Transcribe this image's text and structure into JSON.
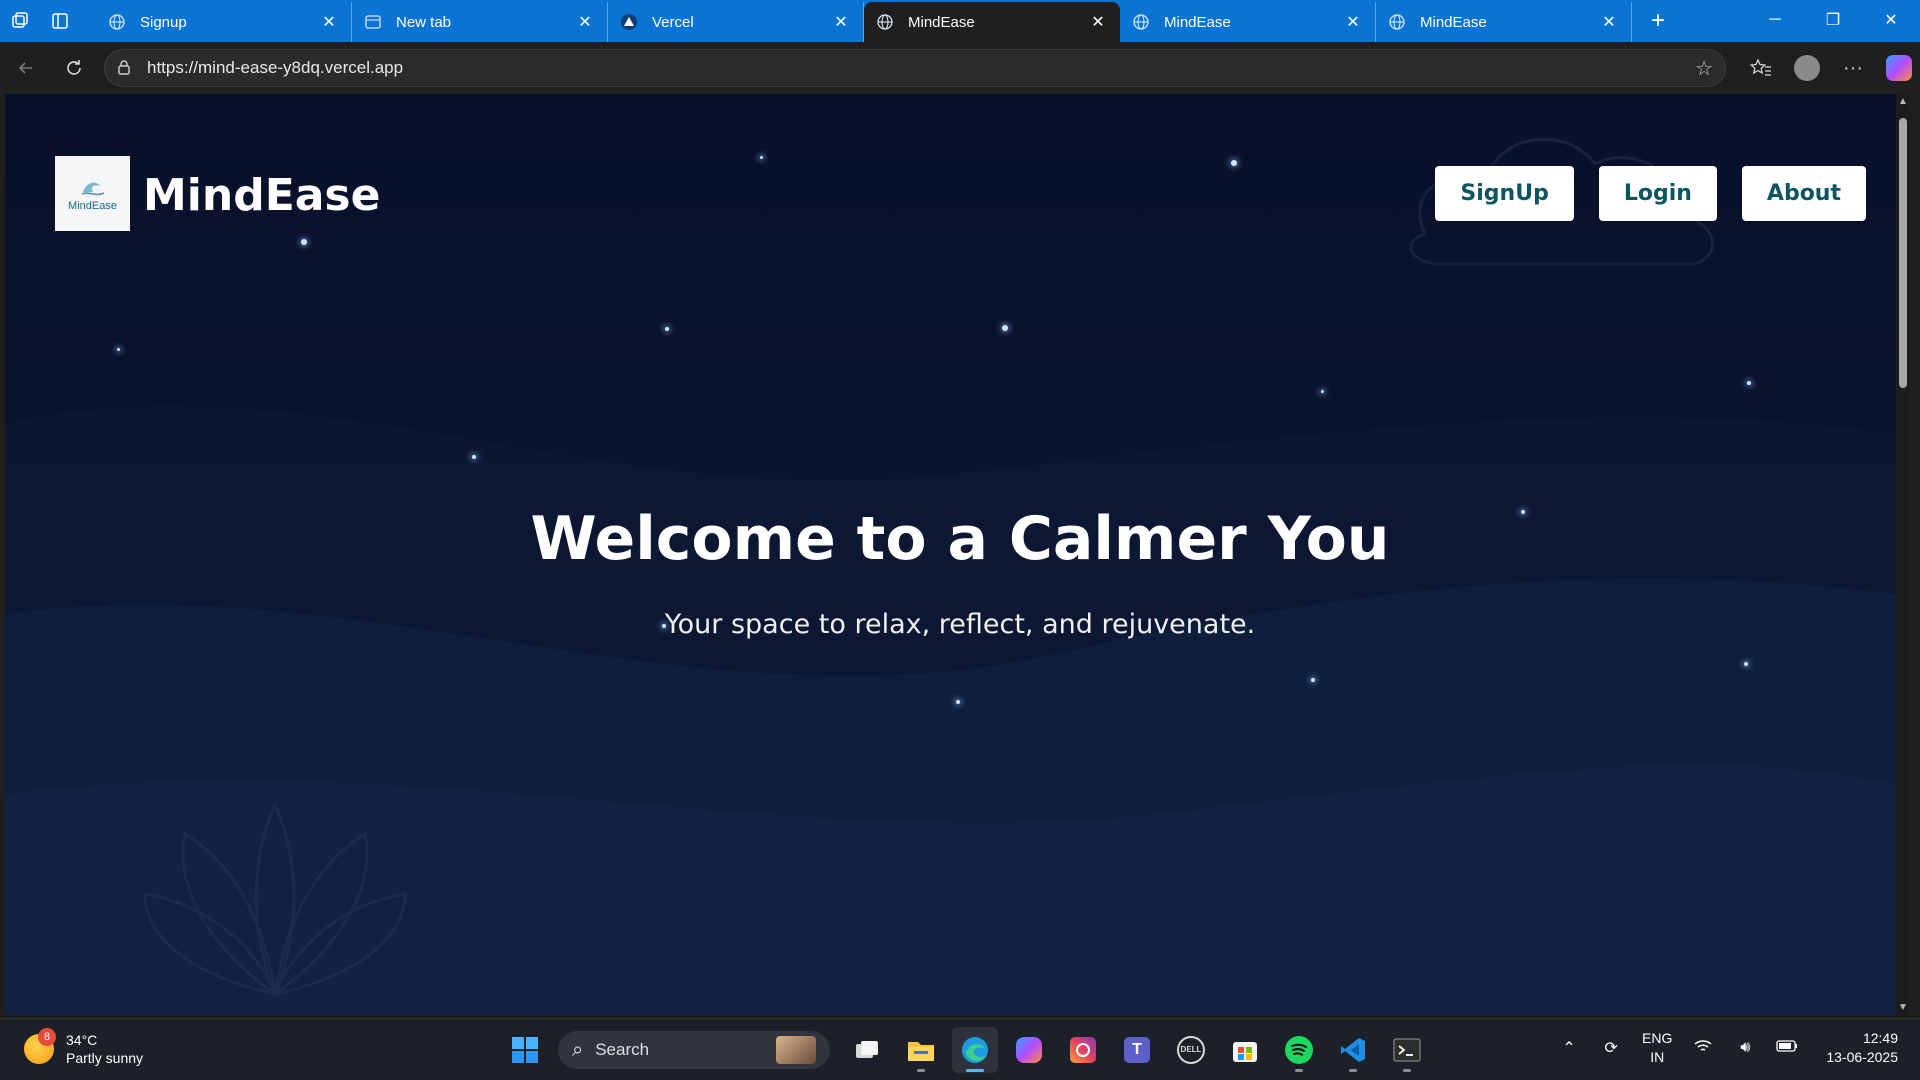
{
  "browser": {
    "tabs": [
      {
        "title": "Signup",
        "icon": "globe-icon",
        "active": false
      },
      {
        "title": "New tab",
        "icon": "newtab-icon",
        "active": false
      },
      {
        "title": "Vercel",
        "icon": "vercel-icon",
        "active": false
      },
      {
        "title": "MindEase",
        "icon": "globe-icon",
        "active": true
      },
      {
        "title": "MindEase",
        "icon": "globe-icon",
        "active": false
      },
      {
        "title": "MindEase",
        "icon": "globe-icon",
        "active": false
      }
    ],
    "url": "https://mind-ease-y8dq.vercel.app",
    "accent_color": "#0a74d4"
  },
  "page": {
    "logo_text": "MindEase",
    "brand": "MindEase",
    "nav": {
      "signup": "SignUp",
      "login": "Login",
      "about": "About"
    },
    "hero_title": "Welcome to a Calmer You",
    "hero_subtitle": "Your space to relax, reflect, and rejuvenate.",
    "button_text_color": "#0d5560",
    "background_color": "#0b1530"
  },
  "taskbar": {
    "weather": {
      "badge": "8",
      "temp": "34°C",
      "condition": "Partly sunny"
    },
    "search_label": "Search",
    "language": {
      "line1": "ENG",
      "line2": "IN"
    },
    "clock": {
      "time": "12:49",
      "date": "13-06-2025"
    }
  }
}
